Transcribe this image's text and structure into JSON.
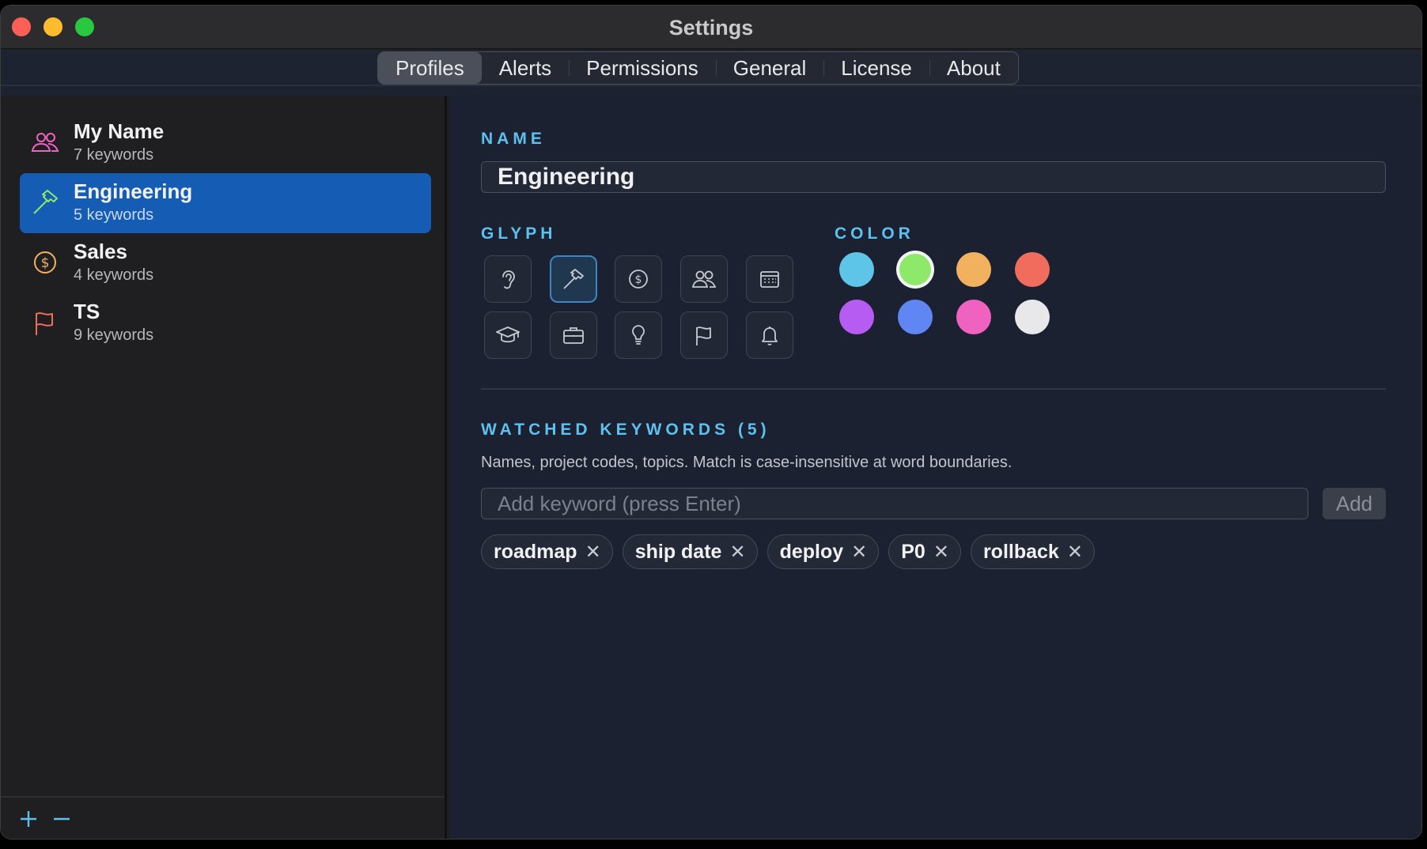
{
  "window": {
    "title": "Settings"
  },
  "tabs": [
    {
      "label": "Profiles",
      "active": true
    },
    {
      "label": "Alerts"
    },
    {
      "label": "Permissions"
    },
    {
      "label": "General"
    },
    {
      "label": "License"
    },
    {
      "label": "About"
    }
  ],
  "sidebar": {
    "profiles": [
      {
        "name": "My Name",
        "count": "7 keywords",
        "icon": "people-icon",
        "color": "#f062c0"
      },
      {
        "name": "Engineering",
        "count": "5 keywords",
        "icon": "hammer-icon",
        "color": "#8ee86a",
        "selected": true
      },
      {
        "name": "Sales",
        "count": "4 keywords",
        "icon": "dollar-circle-icon",
        "color": "#f2b15f"
      },
      {
        "name": "TS",
        "count": "9 keywords",
        "icon": "flag-icon",
        "color": "#f06c5c"
      }
    ],
    "footer": {
      "add": "+",
      "remove": "−"
    }
  },
  "editor": {
    "name_label": "NAME",
    "name_value": "Engineering",
    "glyph_label": "GLYPH",
    "glyphs": [
      "ear-icon",
      "hammer-icon",
      "dollar-circle-icon",
      "people-icon",
      "calendar-icon",
      "graduation-cap-icon",
      "briefcase-icon",
      "lightbulb-icon",
      "flag-icon",
      "bell-icon"
    ],
    "selected_glyph": "hammer-icon",
    "color_label": "COLOR",
    "colors": [
      "#5ec4e8",
      "#8ee86a",
      "#f2b15f",
      "#f06c5c",
      "#b65cf2",
      "#5f86f2",
      "#f062c0",
      "#e8e8ea"
    ],
    "selected_color": "#8ee86a",
    "keywords_label": "WATCHED KEYWORDS (5)",
    "keywords_help": "Names, project codes, topics. Match is case-insensitive at word boundaries.",
    "keyword_placeholder": "Add keyword (press Enter)",
    "add_label": "Add",
    "keywords": [
      "roadmap",
      "ship date",
      "deploy",
      "P0",
      "rollback"
    ],
    "remove_glyph": "✕"
  }
}
